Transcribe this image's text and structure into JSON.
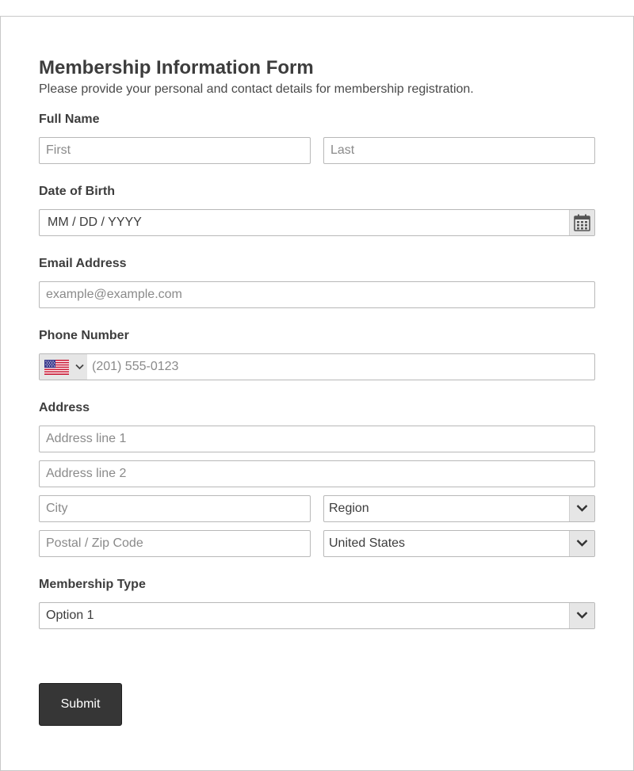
{
  "form": {
    "title": "Membership Information Form",
    "subtitle": "Please provide your personal and contact details for membership registration.",
    "full_name": {
      "label": "Full Name",
      "first_placeholder": "First",
      "last_placeholder": "Last"
    },
    "dob": {
      "label": "Date of Birth",
      "placeholder": "MM / DD / YYYY",
      "icon": "calendar-icon"
    },
    "email": {
      "label": "Email Address",
      "placeholder": "example@example.com"
    },
    "phone": {
      "label": "Phone Number",
      "placeholder": "(201) 555-0123",
      "country_flag": "us-flag-icon"
    },
    "address": {
      "label": "Address",
      "line1_placeholder": "Address line 1",
      "line2_placeholder": "Address line 2",
      "city_placeholder": "City",
      "region_value": "Region",
      "postal_placeholder": "Postal / Zip Code",
      "country_value": "United States"
    },
    "membership_type": {
      "label": "Membership Type",
      "value": "Option 1"
    },
    "submit_label": "Submit"
  },
  "colors": {
    "submit_bg": "#363636",
    "text": "#3d3d3d",
    "border": "#b8b8b8"
  }
}
